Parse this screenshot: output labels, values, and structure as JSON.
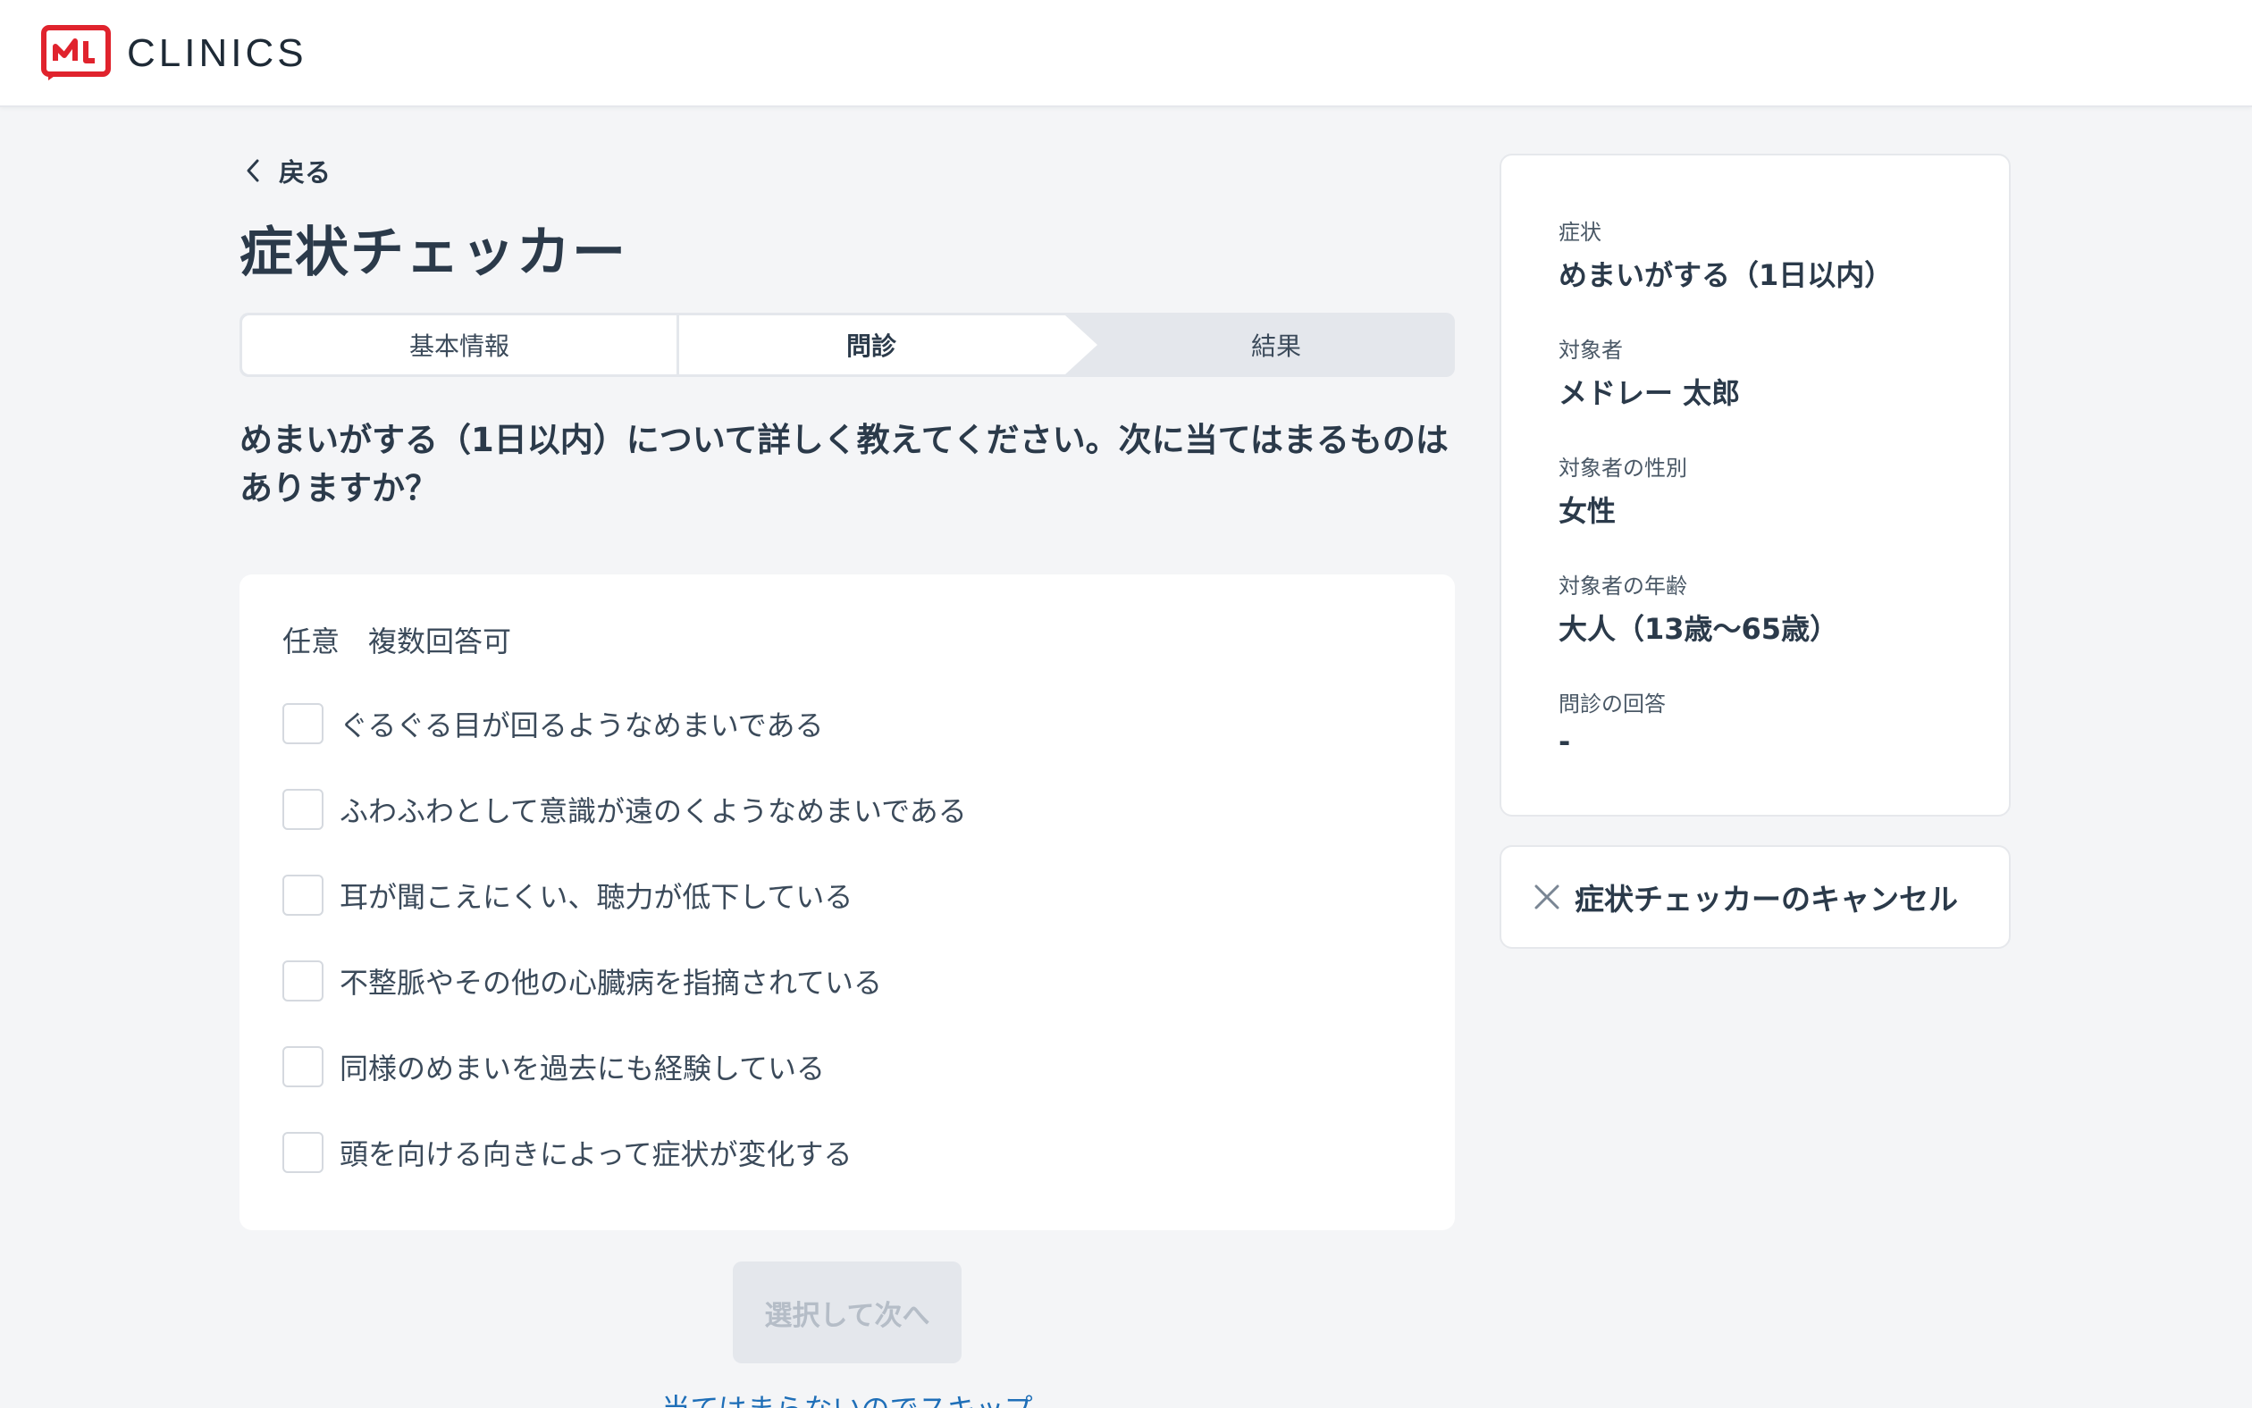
{
  "brand": {
    "name": "CLINICS",
    "logo_icon": "clinics-logo-icon",
    "accent": "#e0232d"
  },
  "nav": {
    "back_label": "戻る",
    "back_icon": "chevron-left-icon"
  },
  "page": {
    "title": "症状チェッカー"
  },
  "stepper": {
    "steps": [
      {
        "label": "基本情報",
        "state": "done"
      },
      {
        "label": "問診",
        "state": "current"
      },
      {
        "label": "結果",
        "state": "upcoming"
      }
    ]
  },
  "question": {
    "text": "めまいがする（1日以内）について詳しく教えてください。次に当てはまるものはありますか？",
    "note": "任意　複数回答可",
    "options": [
      {
        "label": "ぐるぐる目が回るようなめまいである",
        "checked": false
      },
      {
        "label": "ふわふわとして意識が遠のくようなめまいである",
        "checked": false
      },
      {
        "label": "耳が聞こえにくい、聴力が低下している",
        "checked": false
      },
      {
        "label": "不整脈やその他の心臓病を指摘されている",
        "checked": false
      },
      {
        "label": "同様のめまいを過去にも経験している",
        "checked": false
      },
      {
        "label": "頭を向ける向きによって症状が変化する",
        "checked": false
      }
    ],
    "next_button": "選択して次へ",
    "skip_link": "当てはまらないのでスキップ"
  },
  "summary": {
    "items": [
      {
        "label": "症状",
        "value": "めまいがする（1日以内）"
      },
      {
        "label": "対象者",
        "value": "メドレー 太郎"
      },
      {
        "label": "対象者の性別",
        "value": "女性"
      },
      {
        "label": "対象者の年齢",
        "value": "大人（13歳〜65歳）"
      },
      {
        "label": "問診の回答",
        "value": "-"
      }
    ]
  },
  "cancel": {
    "label": "症状チェッカーのキャンセル",
    "icon": "close-icon"
  }
}
